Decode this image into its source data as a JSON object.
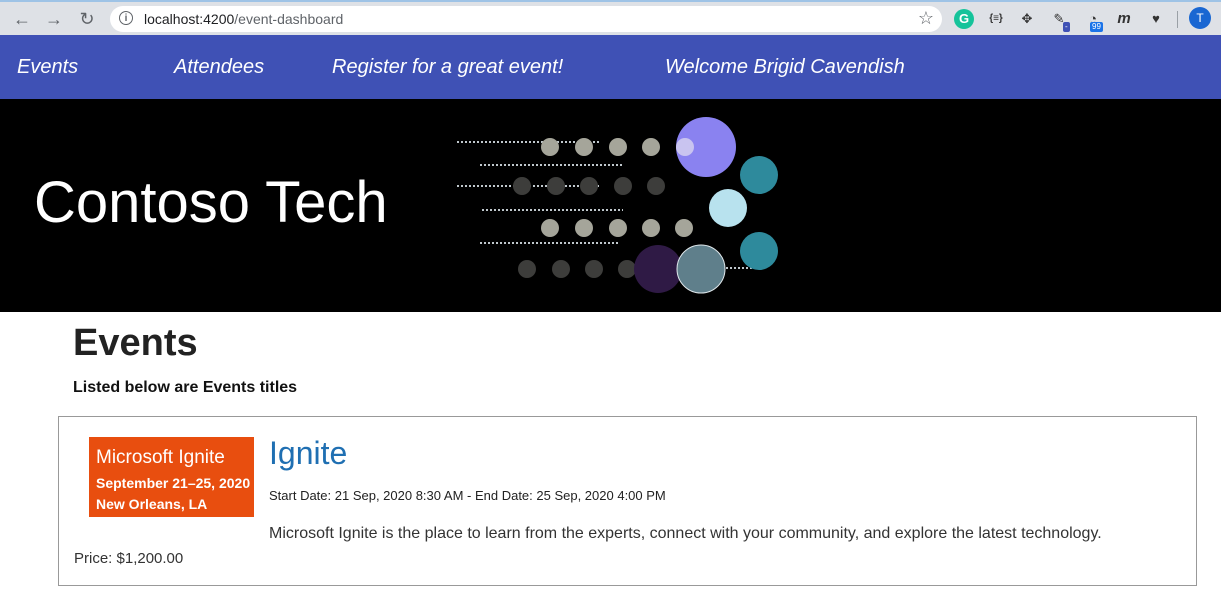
{
  "browser": {
    "url_host": "localhost:4200",
    "url_path": "/event-dashboard",
    "ext_badge_1": "-",
    "ext_badge_2": "99",
    "profile_initial": "T"
  },
  "nav": {
    "events": "Events",
    "attendees": "Attendees",
    "register": "Register for a great event!",
    "welcome": "Welcome Brigid Cavendish"
  },
  "banner": {
    "title": "Contoso Tech"
  },
  "main": {
    "title": "Events",
    "subtitle": "Listed below are Events titles"
  },
  "events": [
    {
      "logo_line1": "Microsoft Ignite",
      "logo_line2": "September 21–25, 2020",
      "logo_line3": "New Orleans, LA",
      "name": "Ignite",
      "dates": "Start Date: 21 Sep, 2020 8:30 AM - End Date: 25 Sep, 2020 4:00 PM",
      "description": "Microsoft Ignite is the place to learn from the experts, connect with your community, and explore the latest technology.",
      "price": "Price: $1,200.00"
    }
  ],
  "colors": {
    "nav_bg": "#3f51b5",
    "event_title": "#1f6fb2",
    "logo_bg": "#e84e0f"
  }
}
